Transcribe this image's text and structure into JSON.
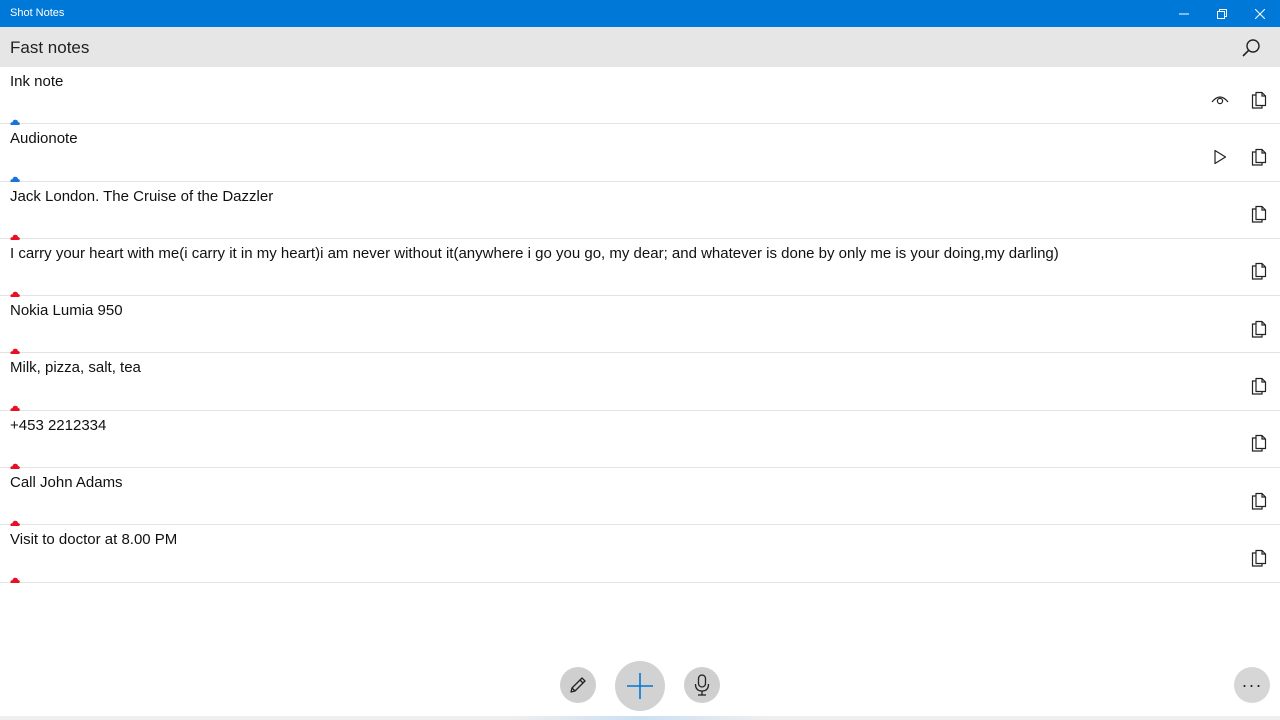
{
  "window": {
    "title": "Shot Notes"
  },
  "header": {
    "title": "Fast notes"
  },
  "colors": {
    "titlebar": "#0078d7",
    "cloud_synced": "#1a73d9",
    "cloud_local": "#e81123",
    "accent": "#0078d7"
  },
  "notes": [
    {
      "text": "Ink note",
      "cloud": "blue",
      "secondary_icon": "eye-icon"
    },
    {
      "text": "Audionote",
      "cloud": "blue",
      "secondary_icon": "play-icon"
    },
    {
      "text": "Jack London. The Cruise of the Dazzler",
      "cloud": "red",
      "secondary_icon": ""
    },
    {
      "text": "I carry your heart with me(i carry it in my heart)i am never without it(anywhere i go you go, my dear; and whatever is done by only me is your doing,my darling)",
      "cloud": "red",
      "secondary_icon": ""
    },
    {
      "text": "Nokia Lumia 950",
      "cloud": "red",
      "secondary_icon": ""
    },
    {
      "text": "Milk, pizza, salt, tea",
      "cloud": "red",
      "secondary_icon": ""
    },
    {
      "text": "+453 2212334",
      "cloud": "red",
      "secondary_icon": ""
    },
    {
      "text": "Call John Adams",
      "cloud": "red",
      "secondary_icon": ""
    },
    {
      "text": "Visit to doctor at 8.00 PM",
      "cloud": "red",
      "secondary_icon": ""
    }
  ],
  "toolbar": {
    "more_label": "···"
  },
  "icons": {
    "search": "search-icon",
    "copy": "copy-icon",
    "edit": "pencil-icon",
    "add": "plus-icon",
    "mic": "microphone-icon",
    "more": "more-icon"
  }
}
